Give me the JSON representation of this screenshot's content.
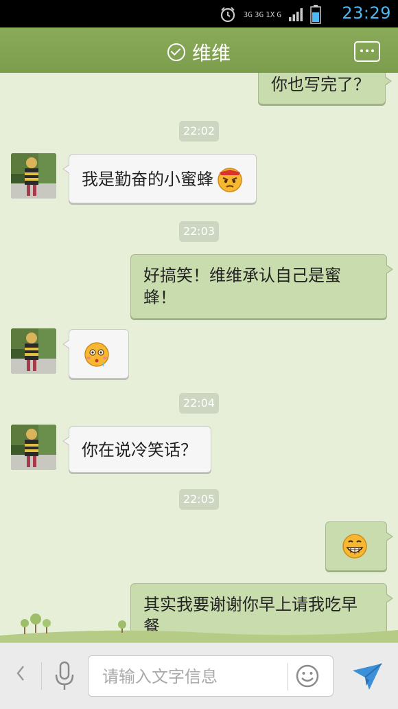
{
  "status_bar": {
    "time": "23:29",
    "network_labels": [
      "3G",
      "3G",
      "1X",
      "G"
    ],
    "accent_color": "#4fb7f2"
  },
  "header": {
    "contact_name": "维维",
    "verified_icon": "check-circle-icon",
    "menu_icon": "more-dots-icon",
    "background_color": "#7b9d4c"
  },
  "messages": [
    {
      "type": "outgoing",
      "text": "你也写完了？"
    },
    {
      "type": "timestamp",
      "text": "22:02"
    },
    {
      "type": "incoming",
      "text": "我是勤奋的小蜜蜂",
      "emoji": "angry-face-emoji"
    },
    {
      "type": "timestamp",
      "text": "22:03"
    },
    {
      "type": "outgoing",
      "text": "好搞笑！维维承认自己是蜜蜂！"
    },
    {
      "type": "incoming",
      "text": "",
      "emoji": "sweating-face-emoji"
    },
    {
      "type": "timestamp",
      "text": "22:04"
    },
    {
      "type": "incoming",
      "text": "你在说冷笑话？"
    },
    {
      "type": "timestamp",
      "text": "22:05"
    },
    {
      "type": "outgoing",
      "text": "",
      "emoji": "grinning-face-emoji"
    },
    {
      "type": "outgoing",
      "text": "其实我要谢谢你早上请我吃早餐"
    }
  ],
  "input_bar": {
    "placeholder": "请输入文字信息",
    "back_icon": "chevron-left-icon",
    "voice_icon": "microphone-icon",
    "emoji_icon": "smiley-icon",
    "send_icon": "send-plane-icon"
  }
}
